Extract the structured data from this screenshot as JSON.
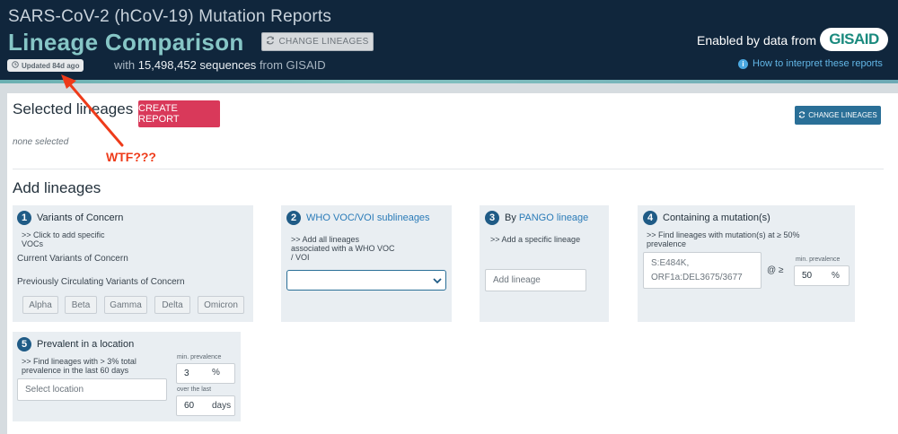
{
  "header": {
    "app_title": "SARS-CoV-2 (hCoV-19) Mutation Reports",
    "page_title": "Lineage Comparison",
    "change_lineages_label": "CHANGE LINEAGES",
    "updated_badge": "Updated 84d ago",
    "sequences_prefix": "with",
    "sequences_count": "15,498,452 sequences",
    "sequences_suffix": "from GISAID",
    "enabled_by": "Enabled by data from",
    "gisaid_logo": "GISAID",
    "how_to_link": "How to interpret these reports"
  },
  "selected": {
    "title": "Selected lineages",
    "create_report_label": "CREATE REPORT",
    "change_lineages_label": "CHANGE LINEAGES",
    "none_selected": "none selected"
  },
  "annotation": {
    "text": "WTF???",
    "color": "#ee3b1a"
  },
  "add": {
    "title": "Add lineages",
    "voc": {
      "number": "1",
      "title": "Variants of Concern",
      "hint_line1": ">> Click to add specific",
      "hint_line2": "VOCs",
      "current_label": "Current Variants of Concern",
      "previous_label": "Previously Circulating Variants of Concern",
      "variants": [
        "Alpha",
        "Beta",
        "Gamma",
        "Delta",
        "Omicron"
      ]
    },
    "who": {
      "number": "2",
      "title": "WHO VOC/VOI sublineages",
      "hint_line1": ">> Add all lineages",
      "hint_line2": "associated with a WHO VOC",
      "hint_line3": "/ VOI",
      "select_value": ""
    },
    "pango": {
      "number": "3",
      "title_prefix": "By",
      "title_link": "PANGO lineage",
      "hint": ">> Add a specific lineage",
      "placeholder": "Add lineage"
    },
    "mutation": {
      "number": "4",
      "title": "Containing a mutation(s)",
      "hint_line1": ">> Find lineages with mutation(s) at ≥ 50%",
      "hint_line2": "prevalence",
      "placeholder_line1": "S:E484K,",
      "placeholder_line2": "ORF1a:DEL3675/3677",
      "at_label": "@ ≥",
      "min_prevalence_label": "min. prevalence",
      "min_prevalence_value": "50",
      "unit": "%"
    },
    "location": {
      "number": "5",
      "title": "Prevalent in a location",
      "hint_line1": ">> Find lineages with > 3% total",
      "hint_line2": "prevalence in the last 60 days",
      "placeholder": "Select location",
      "min_prevalence_label": "min. prevalence",
      "min_prevalence_value": "3",
      "prevalence_unit": "%",
      "over_last_label": "over the last",
      "days_value": "60",
      "days_unit": "days"
    }
  },
  "colors": {
    "header_bg": "#10263c",
    "title_teal": "#86c6c6",
    "create_btn": "#d9395a",
    "primary_btn": "#2a6f97",
    "link": "#2a7bb8"
  }
}
